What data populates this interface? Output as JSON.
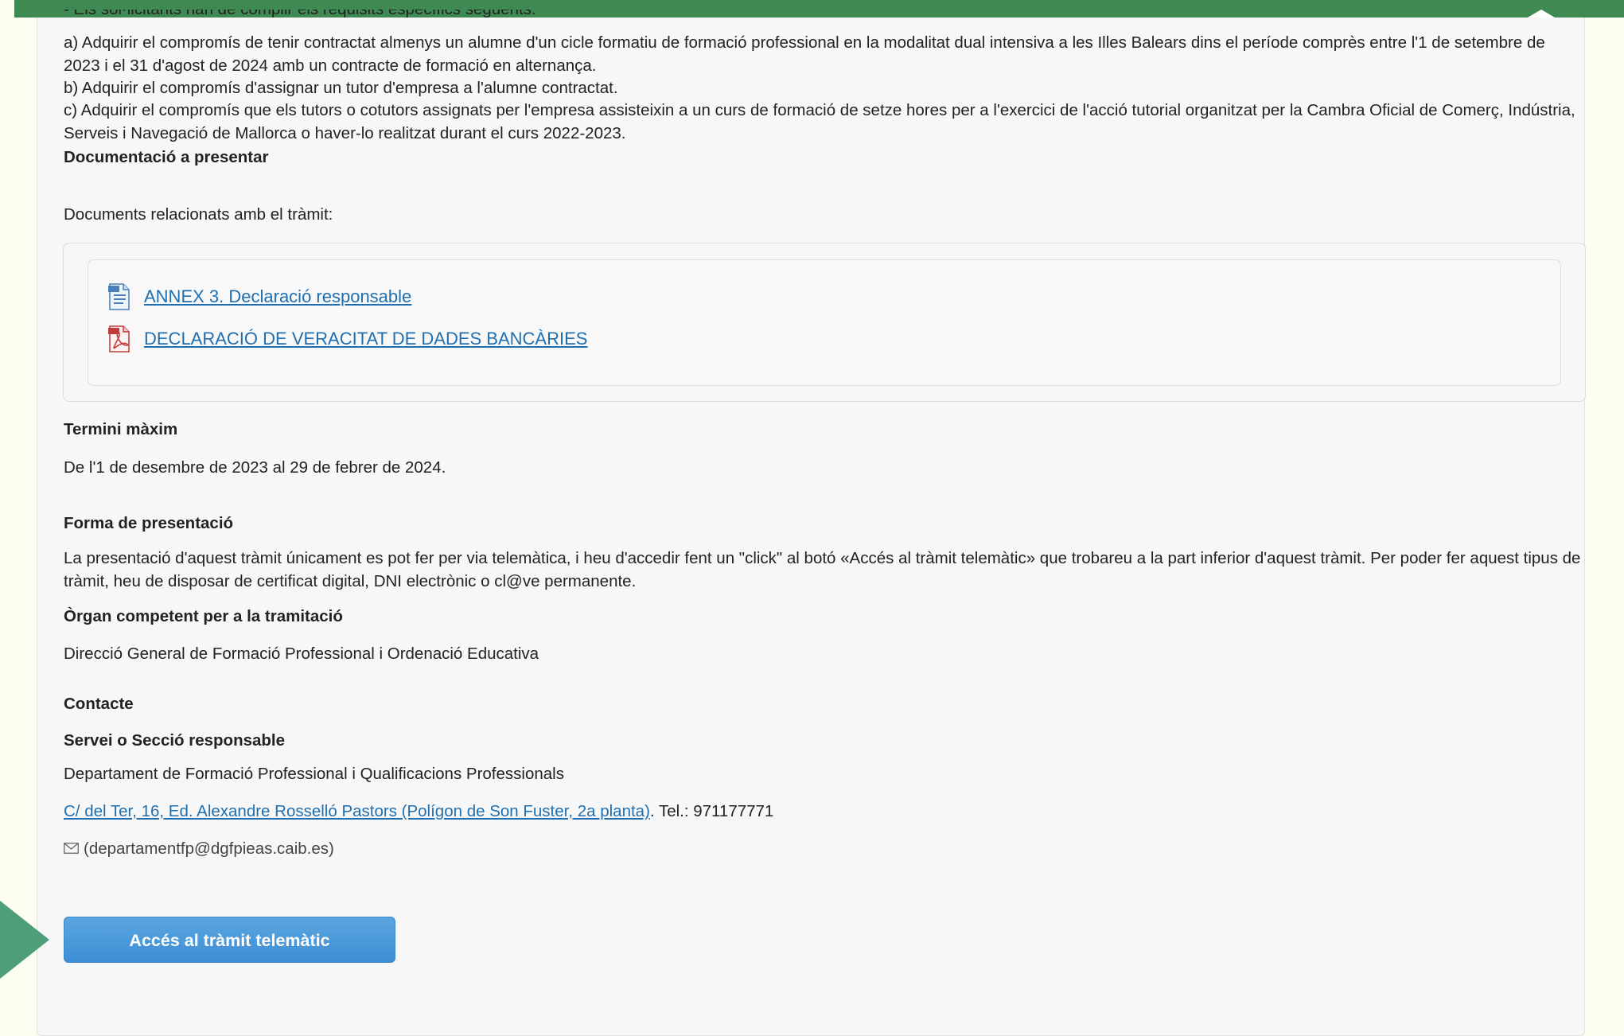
{
  "top_clipped_text": "- Els sol·licitants han de complir els requisits específics següents:",
  "requirements": {
    "a": "a) Adquirir el compromís de tenir contractat almenys un alumne d'un cicle formatiu de formació professional en la modalitat dual intensiva a les Illes Balears dins el període comprès entre l'1 de setembre de 2023 i el 31 d'agost de 2024 amb un contracte de formació en alternança.",
    "b": "b) Adquirir el compromís d'assignar un tutor d'empresa a l'alumne contractat.",
    "c": "c) Adquirir el compromís que els tutors o cotutors assignats per l'empresa assisteixin a un curs de formació de setze hores per a l'exercici de l'acció tutorial organitzat per la Cambra Oficial de Comerç, Indústria, Serveis i Navegació de Mallorca o haver-lo realitzat durant el curs 2022-2023."
  },
  "documentation": {
    "heading": "Documentació a presentar",
    "intro": "Documents relacionats amb el tràmit:",
    "items": [
      {
        "label": "ANNEX 3. Declaració responsable",
        "icon": "odt-document-icon"
      },
      {
        "label": "DECLARACIÓ DE VERACITAT DE DADES BANCÀRIES",
        "icon": "pdf-document-icon"
      }
    ]
  },
  "deadline": {
    "heading": "Termini màxim",
    "text": "De l'1 de desembre de 2023 al 29 de febrer de 2024."
  },
  "presentation": {
    "heading": "Forma de presentació",
    "text": "La presentació d'aquest tràmit únicament es pot fer per via telemàtica, i heu d'accedir fent un \"click\" al botó «Accés al tràmit telemàtic» que trobareu a la part inferior d'aquest tràmit. Per poder fer aquest tipus de tràmit, heu de disposar de certificat digital, DNI electrònic o cl@ve permanente."
  },
  "organ": {
    "heading": "Òrgan competent per a la tramitació",
    "text": "Direcció General de Formació Professional i Ordenació Educativa"
  },
  "contact": {
    "heading": "Contacte",
    "service_heading": "Servei o Secció responsable",
    "department": "Departament de Formació Professional i Qualificacions Professionals",
    "address_link": "C/ del Ter, 16, Ed. Alexandre Rosselló Pastors (Polígon de Son Fuster, 2a planta)",
    "phone_text": ". Tel.: 971177771",
    "email_text": "(departamentfp@dgfpieas.caib.es)"
  },
  "access_button_label": "Accés al tràmit telemàtic",
  "colors": {
    "topbar": "#3f8a52",
    "link": "#1f6fb0",
    "button": "#4a9ad9",
    "arrow": "#4e9e7a"
  }
}
